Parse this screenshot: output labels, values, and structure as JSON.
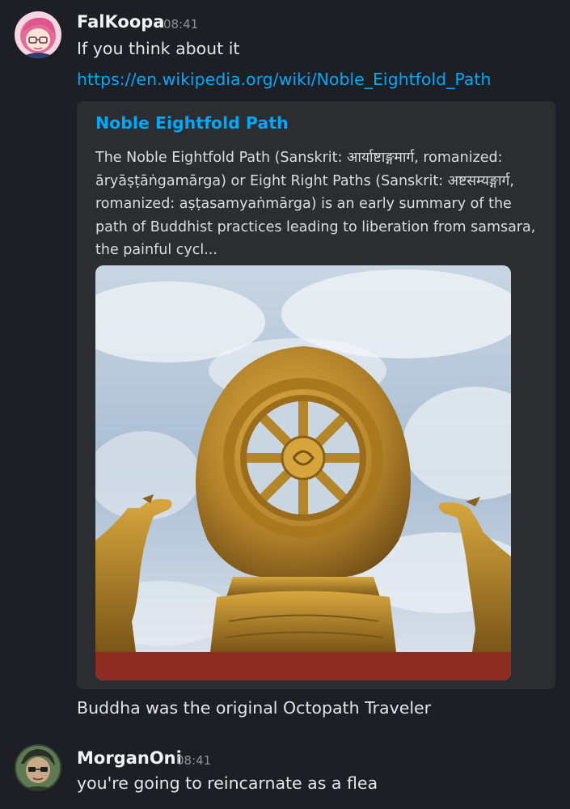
{
  "messages": [
    {
      "author": "FalKoopa",
      "time": "08:41",
      "lines": [
        "If you think about it"
      ],
      "link": "https://en.wikipedia.org/wiki/Noble_Eightfold_Path",
      "embed": {
        "title": "Noble Eightfold Path",
        "description_lines": [
          "The Noble Eightfold Path (Sanskrit: आर्याष्टाङ्गमार्ग, romanized:",
          "āryāṣṭāṅgamārga) or Eight Right Paths (Sanskrit: अष्टसम्यङ्गार्ग,",
          "romanized: aṣṭasamyaṅmārga) is an early summary of the",
          "path of Buddhist practices leading to liberation from samsara,",
          "the painful cycl..."
        ],
        "image_icon": "dharma-wheel-photo"
      },
      "followup": "Buddha was the original Octopath Traveler"
    },
    {
      "author": "MorganOni",
      "time": "08:41",
      "lines": [
        "you're going to reincarnate as a flea"
      ]
    }
  ]
}
